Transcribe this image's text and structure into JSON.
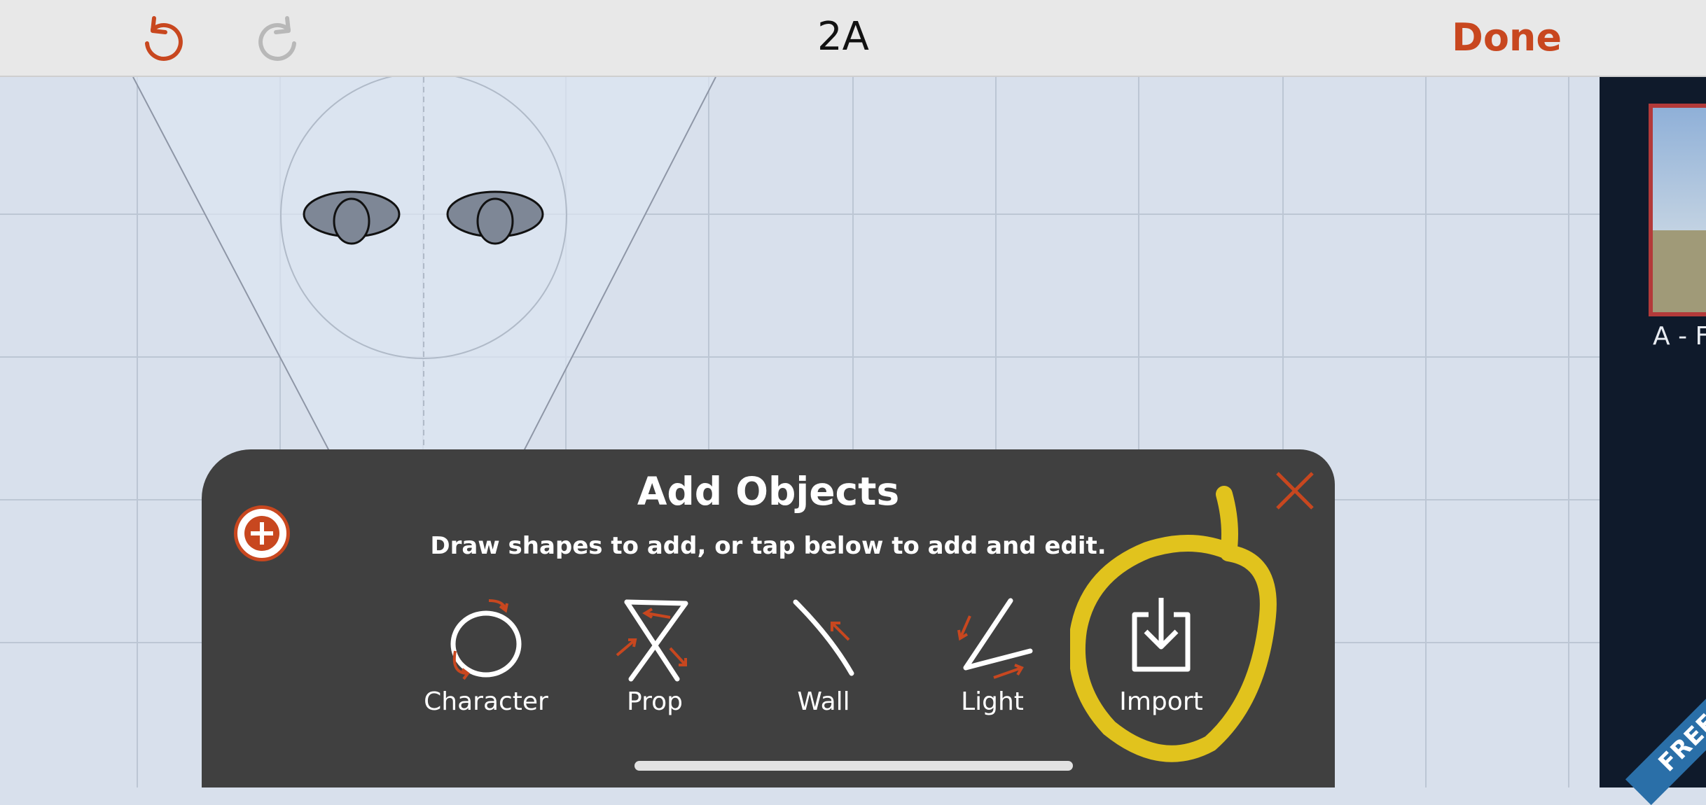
{
  "toolbar": {
    "title": "2A",
    "done_label": "Done",
    "undo_icon": "undo-icon",
    "redo_icon": "redo-icon"
  },
  "add_objects": {
    "title": "Add Objects",
    "subtitle": "Draw shapes to add, or tap below to add and edit.",
    "tools": [
      {
        "label": "Character",
        "icon": "character-icon"
      },
      {
        "label": "Prop",
        "icon": "prop-icon"
      },
      {
        "label": "Wall",
        "icon": "wall-icon"
      },
      {
        "label": "Light",
        "icon": "light-icon"
      },
      {
        "label": "Import",
        "icon": "import-icon"
      }
    ]
  },
  "shots_panel": {
    "thumbnail_label": "A - F",
    "badge": "FREE"
  },
  "colors": {
    "accent": "#c8471f",
    "panel": "#404040",
    "canvas": "#d8e0ec",
    "highlight": "#f3d21a"
  }
}
